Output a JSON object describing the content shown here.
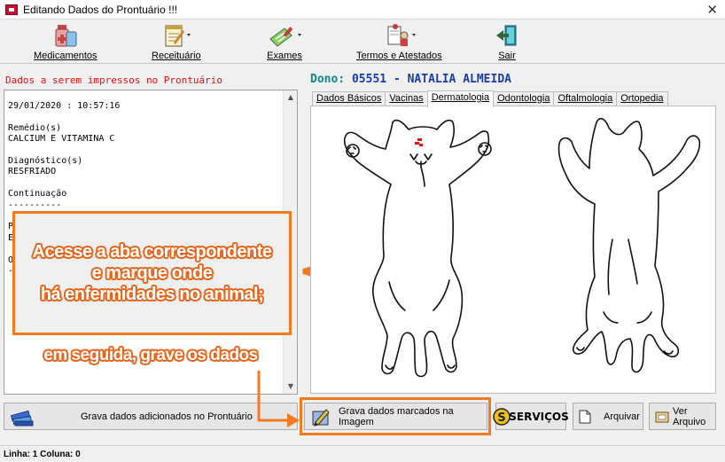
{
  "window": {
    "title": "Editando Dados do Prontuário !!!"
  },
  "toolbar": {
    "medicamentos": "Medicamentos",
    "receituario": "Receituário",
    "exames": "Exames",
    "termos": "Termos e Atestados",
    "sair": "Sair"
  },
  "notes": {
    "heading": "Dados a serem impressos no Prontuário",
    "content": "29/01/2020 : 10:57:16\n\nRemédio(s)\nCALCIUM E VITAMINA C\n\nDiagnóstico(s)\nRESFRIADO\n\nContinuação\n----------\n\nP\nE\n\nO\n-"
  },
  "owner": {
    "label": "Dono:",
    "code": "05551",
    "separator": "-",
    "name": "NATALIA ALMEIDA"
  },
  "tabs": [
    "Dados Básicos",
    "Vacinas",
    "Dermatologia",
    "Odontologia",
    "Oftalmologia",
    "Ortopedia"
  ],
  "active_tab": "Dermatologia",
  "buttons": {
    "grava_prontuario": "Grava dados adicionados no Prontuário",
    "grava_imagem": "Grava dados marcados na Imagem",
    "servicos": "SERVIÇOS",
    "arquivar": "Arquivar",
    "ver_arquivo": "Ver Arquivo"
  },
  "status": {
    "text": "Linha: 1 Coluna: 0"
  },
  "annotation": {
    "line1": "Acesse a aba correspondente",
    "line2": "e marque onde",
    "line3": "há enfermidades no animal;",
    "line4": "em seguida, grave os dados"
  },
  "colors": {
    "accent_orange": "#f47a20",
    "heading_red": "#e01010",
    "owner_label": "#0a8a8a",
    "owner_value": "#1a3ca8"
  }
}
